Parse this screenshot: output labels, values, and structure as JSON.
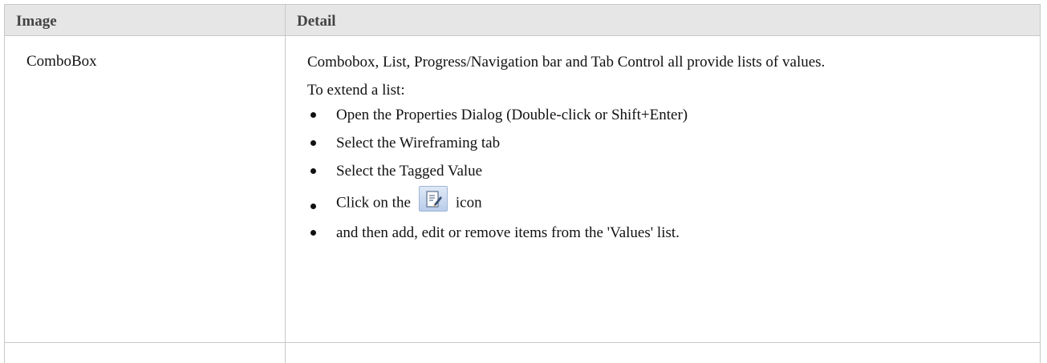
{
  "table": {
    "headers": {
      "image": "Image",
      "detail": "Detail"
    },
    "row": {
      "image_text": "ComboBox",
      "detail_paragraph_1": "Combobox, List, Progress/Navigation bar and Tab Control all provide lists of values.",
      "detail_paragraph_2": "To extend a list:",
      "bullets": [
        {
          "text": "Open the Properties Dialog (Double-click or Shift+Enter)"
        },
        {
          "text": "Select the Wireframing tab"
        },
        {
          "text": "Select the Tagged Value"
        },
        {
          "text_before": "Click on the",
          "icon": "edit-document-icon",
          "text_after": "icon"
        },
        {
          "text": "and then add, edit or remove items from the 'Values' list."
        }
      ]
    }
  }
}
